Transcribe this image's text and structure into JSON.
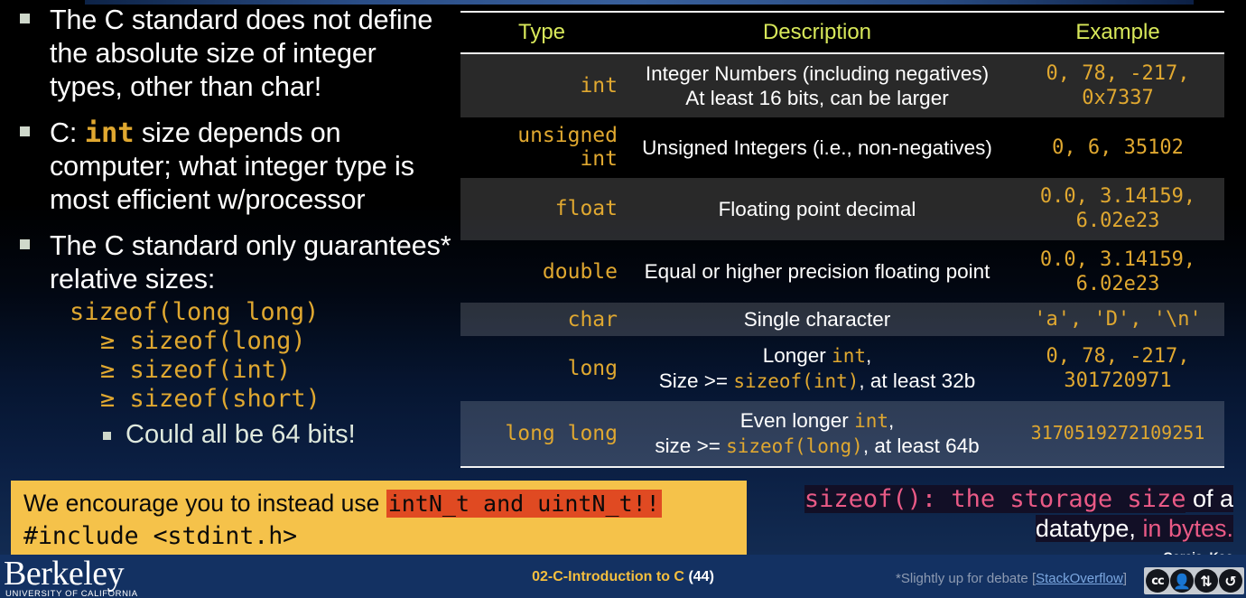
{
  "slide": {
    "bullets": [
      {
        "pre": "The C standard does not define the absolute size of integer types, other than char!"
      },
      {
        "pre": "C: ",
        "code": "int",
        "post": " size depends on computer; what integer type is most efficient w/processor"
      },
      {
        "pre": "The C standard only guarantees* relative sizes:"
      }
    ],
    "code_lines": [
      "sizeof(long long)",
      "≥ sizeof(long)",
      "≥ sizeof(int)",
      "≥ sizeof(short)"
    ],
    "sub_bullet": "Could all be 64 bits!"
  },
  "table": {
    "headers": [
      "Type",
      "Description",
      "Example"
    ],
    "rows": [
      {
        "type": "int",
        "desc_line1": "Integer Numbers (including negatives)",
        "desc_line2": "At least 16 bits, can be larger",
        "example": "0, 78, -217,\n0x7337",
        "shaded": true
      },
      {
        "type": "unsigned\nint",
        "desc_line1": "Unsigned Integers (i.e., non-negatives)",
        "desc_line2": "",
        "example": "0, 6, 35102",
        "shaded": false
      },
      {
        "type": "float",
        "desc_line1": "Floating point decimal",
        "desc_line2": "",
        "example": "0.0, 3.14159,\n6.02e23",
        "shaded": true
      },
      {
        "type": "double",
        "desc_line1": "Equal or higher precision floating point",
        "desc_line2": "",
        "example": "0.0, 3.14159,\n6.02e23",
        "shaded": false
      },
      {
        "type": "char",
        "desc_line1": "Single character",
        "desc_line2": "",
        "example": "'a', 'D', '\\n'",
        "shaded": true
      },
      {
        "type": "long",
        "desc_line1": "Longer int,",
        "desc_line2": "Size >= sizeof(int), at least 32b",
        "example": "0, 78, -217,\n301720971",
        "shaded": false
      },
      {
        "type": "long long",
        "desc_line1": "Even longer int,",
        "desc_line2": "size >= sizeof(long), at least 64b",
        "example": "3170519272109251",
        "shaded": true
      }
    ]
  },
  "callout": {
    "line1_a": "We encourage you to instead use ",
    "line1_b": "intN_t and uintN_t!!",
    "line2": "#include <stdint.h>"
  },
  "right_note": {
    "part1": "sizeof(): the storage size",
    "part2": " of a",
    "part3": "datatype, ",
    "part4": "in bytes.",
    "authors": "Garcia, Kao"
  },
  "footer": {
    "logo": "Berkeley",
    "logo_sub": "UNIVERSITY OF CALIFORNIA",
    "deck": "02-C-Introduction to C",
    "page": "(44)",
    "footnote_pre": "*Slightly up for debate [",
    "footnote_link": "StackOverflow",
    "footnote_post": "]",
    "cc_badges": [
      "cc",
      "BY",
      "NC",
      "SA"
    ]
  },
  "colors": {
    "amber": "#e0a830",
    "header_yellow": "#d8e85a",
    "callout_bg": "#f5c24a",
    "highlight_red": "#e04a22",
    "pink": "#ea5a86",
    "footer_blue": "#133162"
  }
}
